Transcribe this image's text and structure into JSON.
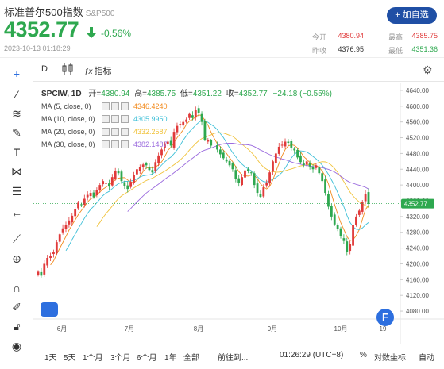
{
  "header": {
    "title": "标准普尔500指数",
    "code": "S&P500",
    "price": "4352.77",
    "change_pct": "-0.56%",
    "timestamp": "2023-10-13 01:18:29",
    "add_button": "+ 加自选",
    "quote": [
      {
        "label": "今开",
        "value": "4380.94",
        "color": "#e03a3a"
      },
      {
        "label": "最高",
        "value": "4385.75",
        "color": "#e03a3a"
      },
      {
        "label": "昨收",
        "value": "4376.95",
        "color": "#333333"
      },
      {
        "label": "最低",
        "value": "4351.36",
        "color": "#2ea84f"
      }
    ]
  },
  "toolbar": {
    "interval": "D",
    "indicator_label": "指标"
  },
  "legend": {
    "symbol": "SPCIW, 1D",
    "open_label": "开=",
    "open": "4380.94",
    "high_label": "高=",
    "high": "4385.75",
    "low_label": "低=",
    "low": "4351.22",
    "close_label": "收=",
    "close": "4352.77",
    "change": "−24.18 (−0.55%)",
    "ma": [
      {
        "name": "MA (5, close, 0)",
        "value": "4346.4240",
        "color": "#f28b1e"
      },
      {
        "name": "MA (10, close, 0)",
        "value": "4305.9950",
        "color": "#40c0d8"
      },
      {
        "name": "MA (20, close, 0)",
        "value": "4332.2587",
        "color": "#f0c23a"
      },
      {
        "name": "MA (30, close, 0)",
        "value": "4382.1487",
        "color": "#9b6bde"
      }
    ]
  },
  "axis": {
    "y_ticks": [
      "4640.00",
      "4600.00",
      "4560.00",
      "4520.00",
      "4480.00",
      "4440.00",
      "4400.00",
      "4360.00",
      "4320.00",
      "4280.00",
      "4240.00",
      "4200.00",
      "4160.00",
      "4120.00",
      "4080.00"
    ],
    "x_ticks": [
      "6月",
      "7月",
      "8月",
      "9月",
      "10月",
      "19"
    ],
    "last_price": "4352.77"
  },
  "bottom": {
    "ranges": [
      "1天",
      "5天",
      "1个月",
      "3个月",
      "6个月",
      "1年",
      "全部"
    ],
    "goto": "前往到...",
    "time": "01:26:29 (UTC+8)",
    "percent": "%",
    "log": "对数坐标",
    "auto": "自动"
  },
  "colors": {
    "up": "#e03a3a",
    "down": "#2ea84f",
    "accent": "#1f4fa5"
  },
  "chart_data": {
    "type": "candlestick",
    "ylim": [
      4060,
      4660
    ],
    "x_labels": [
      "6月",
      "7月",
      "8月",
      "9月",
      "10月",
      "19"
    ],
    "last": 4352.77,
    "closes": [
      4180,
      4170,
      4200,
      4215,
      4221,
      4230,
      4255,
      4275,
      4290,
      4298,
      4310,
      4322,
      4338,
      4355,
      4350,
      4365,
      4375,
      4380,
      4369,
      4388,
      4400,
      4410,
      4405,
      4396,
      4420,
      4436,
      4430,
      4410,
      4398,
      4390,
      4408,
      4425,
      4440,
      4446,
      4452,
      4450,
      4438,
      4432,
      4458,
      4475,
      4490,
      4505,
      4510,
      4500,
      4535,
      4550,
      4555,
      4560,
      4566,
      4580,
      4570,
      4590,
      4582,
      4560,
      4515,
      4514,
      4500,
      4505,
      4490,
      4478,
      4468,
      4460,
      4450,
      4440,
      4415,
      4405,
      4420,
      4437,
      4436,
      4430,
      4400,
      4380,
      4370,
      4394,
      4406,
      4432,
      4460,
      4480,
      4497,
      4502,
      4510,
      4507,
      4495,
      4488,
      4470,
      4458,
      4450,
      4460,
      4447,
      4440,
      4450,
      4430,
      4410,
      4380,
      4345,
      4320,
      4300,
      4288,
      4270,
      4258,
      4230,
      4250,
      4299,
      4320,
      4335,
      4358,
      4377,
      4352
    ]
  }
}
